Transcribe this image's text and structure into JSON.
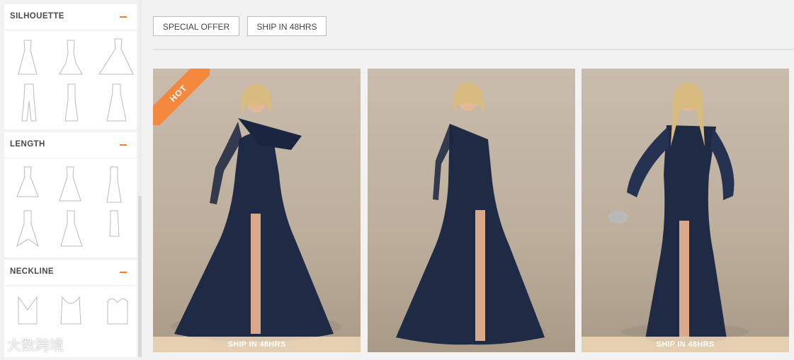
{
  "filters": {
    "silhouette": {
      "title": "SILHOUETTE"
    },
    "length": {
      "title": "LENGTH"
    },
    "neckline": {
      "title": "NECKLINE"
    }
  },
  "tags": {
    "special_offer": "SPECIAL OFFER",
    "ship_48": "SHIP IN 48HRS"
  },
  "products": [
    {
      "badge": "HOT",
      "banner": "SHIP IN 48HRS"
    },
    {
      "badge": "",
      "banner": ""
    },
    {
      "badge": "",
      "banner": "SHIP IN 48HRS"
    }
  ],
  "watermark": "大数跨境",
  "colors": {
    "accent": "#f0802e",
    "dress_navy": "#1f2a44"
  },
  "icons": {
    "collapse": "minus-icon"
  }
}
